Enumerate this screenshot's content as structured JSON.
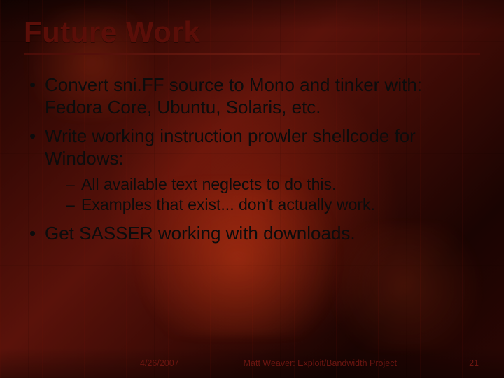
{
  "title": "Future Work",
  "bullets": [
    {
      "text": "Convert sni.FF source to Mono and tinker with: Fedora Core, Ubuntu, Solaris, etc.",
      "sub": []
    },
    {
      "text": "Write working instruction prowler shellcode for Windows:",
      "sub": [
        "All available text neglects to do this.",
        "Examples that exist... don't actually work."
      ]
    },
    {
      "text": "Get SASSER working with downloads.",
      "sub": []
    }
  ],
  "footer": {
    "date": "4/26/2007",
    "project": "Matt Weaver: Exploit/Bandwidth Project",
    "page": "21"
  }
}
